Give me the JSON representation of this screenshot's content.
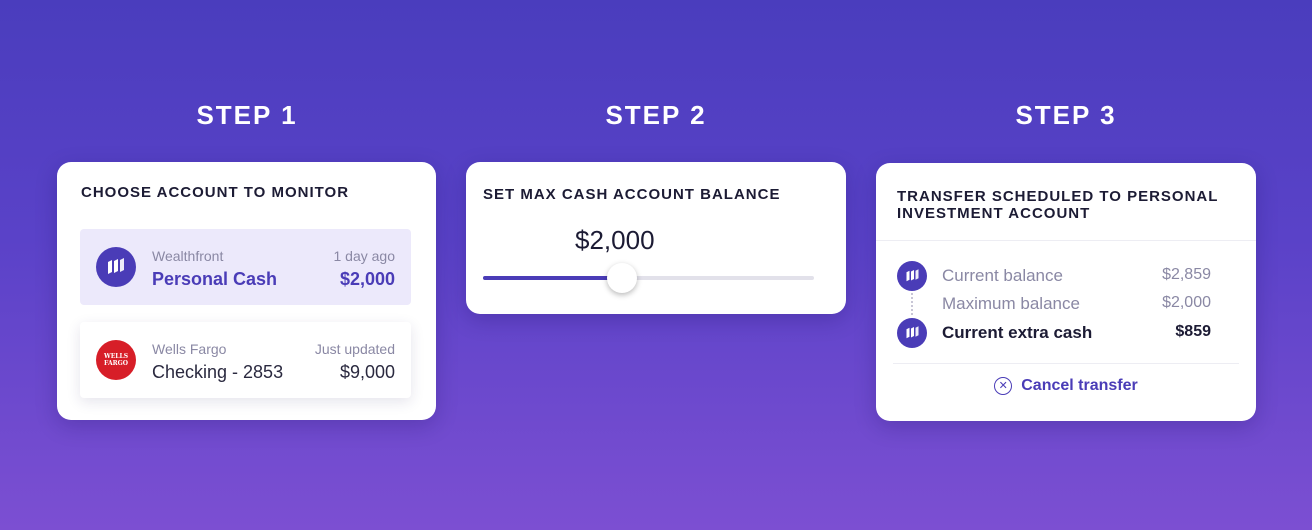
{
  "steps": [
    {
      "title": "STEP 1"
    },
    {
      "title": "STEP 2"
    },
    {
      "title": "STEP 3"
    }
  ],
  "step1": {
    "heading": "CHOOSE ACCOUNT TO MONITOR",
    "accounts": [
      {
        "provider": "Wealthfront",
        "name": "Personal Cash",
        "updated": "1 day ago",
        "balance": "$2,000",
        "icon": "wealthfront-logo-icon",
        "selected": true
      },
      {
        "provider": "Wells Fargo",
        "name": "Checking - 2853",
        "updated": "Just updated",
        "balance": "$9,000",
        "icon": "wells-fargo-logo-icon",
        "logo_text": "WELLS FARGO",
        "selected": false
      }
    ]
  },
  "step2": {
    "heading": "SET MAX CASH ACCOUNT BALANCE",
    "amount": "$2,000",
    "slider_fraction": 0.42
  },
  "step3": {
    "heading": "TRANSFER SCHEDULED TO PERSONAL INVESTMENT ACCOUNT",
    "rows": [
      {
        "label": "Current balance",
        "value": "$2,859"
      },
      {
        "label": "Maximum balance",
        "value": "$2,000"
      },
      {
        "label": "Current extra cash",
        "value": "$859"
      }
    ],
    "cancel_label": "Cancel transfer",
    "cancel_icon": "close-circle-icon"
  },
  "colors": {
    "accent": "#4a3cb7",
    "wells_red": "#d71e28",
    "background_top": "#4a3dbd",
    "background_bottom": "#7c4fd2"
  }
}
